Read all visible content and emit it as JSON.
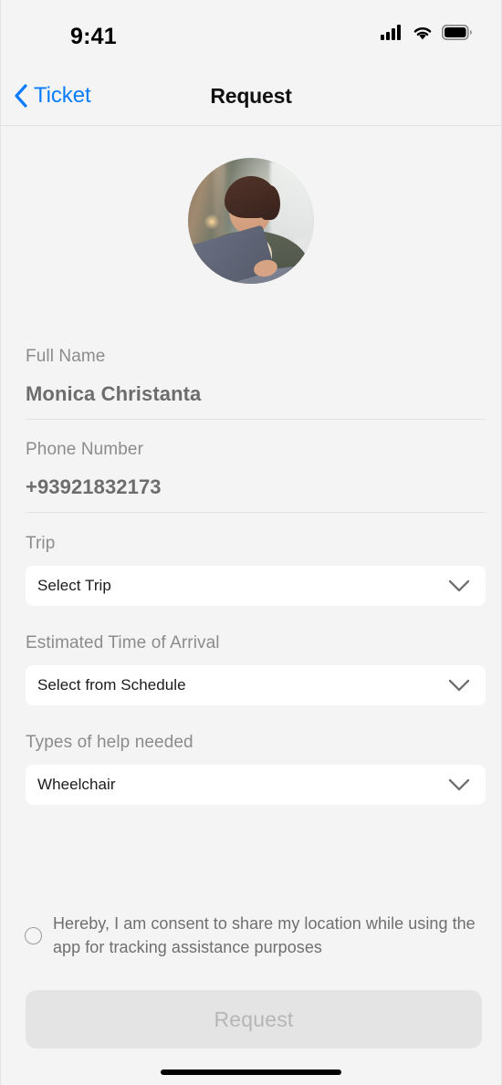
{
  "status_bar": {
    "time": "9:41",
    "icons": {
      "signal": "cellular-signal-icon",
      "wifi": "wifi-icon",
      "battery": "battery-full-icon"
    }
  },
  "nav_bar": {
    "back_label": "Ticket",
    "back_icon": "chevron-left-icon",
    "title": "Request",
    "accent_color": "#0a7cff"
  },
  "profile": {
    "avatar_alt": "user-avatar-photo"
  },
  "form": {
    "fields": [
      {
        "label": "Full Name",
        "value": "Monica Christanta"
      },
      {
        "label": "Phone Number",
        "value": "+93921832173"
      }
    ],
    "selects": [
      {
        "label": "Trip",
        "value": "Select Trip",
        "icon": "chevron-down-icon"
      },
      {
        "label": "Estimated Time of Arrival",
        "value": "Select from Schedule",
        "icon": "chevron-down-icon"
      },
      {
        "label": "Types of help needed",
        "value": "Wheelchair",
        "icon": "chevron-down-icon"
      }
    ],
    "consent": {
      "text": "Hereby, I am consent to share my location while using the app for tracking assistance purposes",
      "checked": false
    },
    "submit_label": "Request",
    "submit_enabled": false
  },
  "colors": {
    "background": "#f4f4f4",
    "card": "#ffffff",
    "label_text": "#8c8c8c",
    "value_text": "#6d6d6d",
    "accent": "#0a7cff",
    "disabled_button_bg": "#e4e4e4",
    "disabled_button_text": "#b6b6b6"
  }
}
